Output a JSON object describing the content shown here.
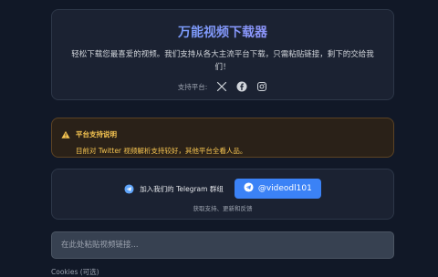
{
  "hero": {
    "title": "万能视频下载器",
    "description": "轻松下载您最喜爱的视频。我们支持从各大主流平台下载，只需粘贴链接，剩下的交给我们！",
    "platforms_label": "支持平台:",
    "platforms": [
      "x-icon",
      "facebook-icon",
      "instagram-icon"
    ]
  },
  "notice": {
    "title": "平台支持说明",
    "text": "目前对 Twitter 视频解析支持较好，其他平台全看人品。",
    "icon": "warning-icon",
    "color": "#f5c451"
  },
  "telegram": {
    "join_text": "加入我们的 Telegram 群组",
    "button_label": "@videodl101",
    "subtext": "获取支持、更新和反馈",
    "icon": "telegram-icon",
    "button_color": "#3b82f6"
  },
  "url_input": {
    "placeholder": "在此处粘贴视频链接...",
    "value": ""
  },
  "cookies": {
    "label": "Cookies (可选)"
  }
}
